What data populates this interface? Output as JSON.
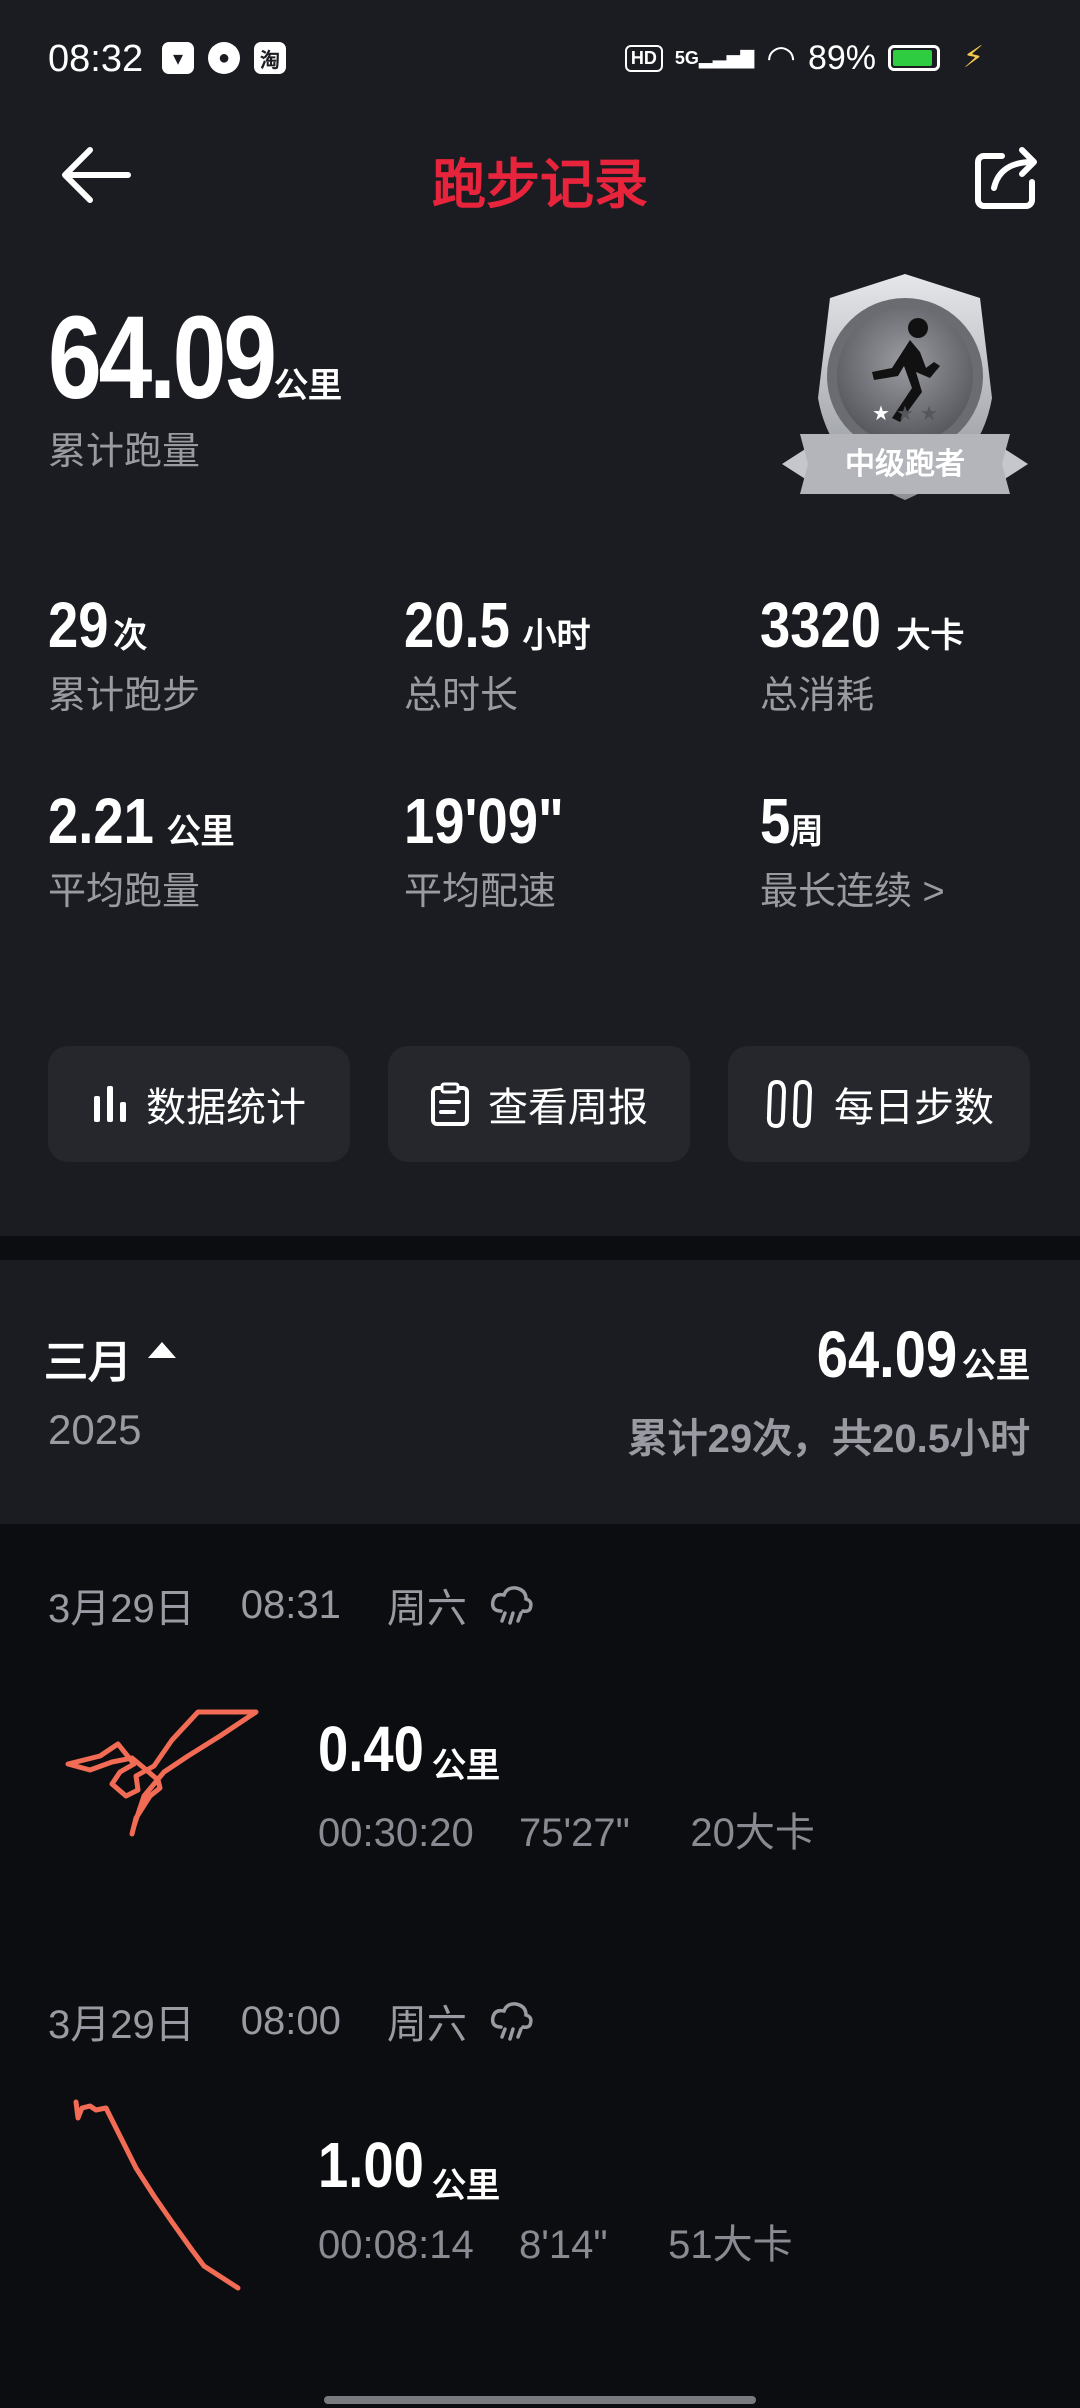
{
  "status_bar": {
    "time": "08:32",
    "app_icons": [
      "notification-icon",
      "wechat-icon",
      "taobao-icon"
    ],
    "hd": "HD",
    "network": "5G",
    "battery": "89%"
  },
  "header": {
    "title": "跑步记录"
  },
  "summary": {
    "total_distance": "64.09",
    "total_unit": "公里",
    "total_label": "累计跑量",
    "badge": "中级跑者"
  },
  "stats": [
    {
      "value": "29",
      "unit": "次",
      "label": "累计跑步"
    },
    {
      "value": "20.5",
      "unit": "小时",
      "label": "总时长"
    },
    {
      "value": "3320",
      "unit": "大卡",
      "label": "总消耗"
    },
    {
      "value": "2.21",
      "unit": "公里",
      "label": "平均跑量"
    },
    {
      "value": "19'09\"",
      "unit": "",
      "label": "平均配速"
    },
    {
      "value": "5",
      "unit": "周",
      "label": "最长连续 >"
    }
  ],
  "buttons": {
    "stats": "数据统计",
    "weekly": "查看周报",
    "steps": "每日步数"
  },
  "month": {
    "name": "三月",
    "year": "2025",
    "distance": "64.09",
    "unit": "公里",
    "summary": "累计29次，共20.5小时"
  },
  "records": [
    {
      "date": "3月29日",
      "time": "08:31",
      "weekday": "周六",
      "weather_icon": "rain-cloud-icon",
      "distance": "0.40",
      "unit": "公里",
      "duration": "00:30:20",
      "pace": "75'27\"",
      "calories": "20大卡"
    },
    {
      "date": "3月29日",
      "time": "08:00",
      "weekday": "周六",
      "weather_icon": "rain-cloud-icon",
      "distance": "1.00",
      "unit": "公里",
      "duration": "00:08:14",
      "pace": "8'14\"",
      "calories": "51大卡"
    }
  ],
  "colors": {
    "accent": "#e8243c",
    "route": "#f26b55",
    "background": "#1b1c21",
    "secondary_text": "#9a9ba2"
  }
}
